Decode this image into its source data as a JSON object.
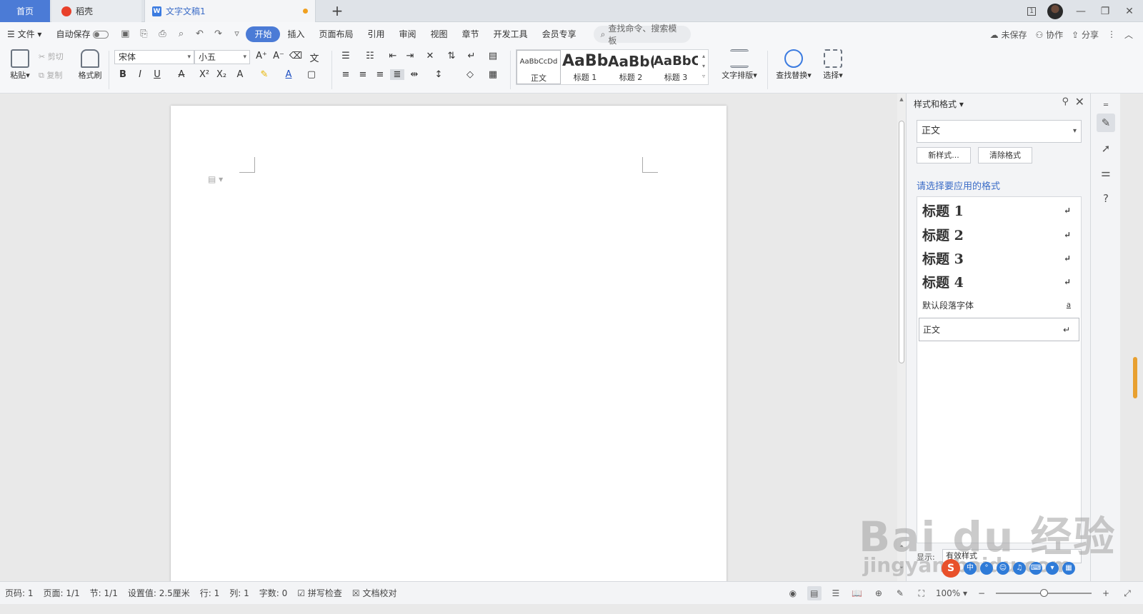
{
  "tabs": {
    "home": "首页",
    "daoke": "稻壳",
    "document": "文字文稿1"
  },
  "window": {
    "page_indicator": "1"
  },
  "menu": {
    "file": "文件",
    "autosave": "自动保存",
    "items": [
      "开始",
      "插入",
      "页面布局",
      "引用",
      "审阅",
      "视图",
      "章节",
      "开发工具",
      "会员专享"
    ],
    "active": "开始",
    "search_placeholder": "查找命令、搜索模板",
    "unsaved": "未保存",
    "collaborate": "协作",
    "share": "分享"
  },
  "ribbon": {
    "paste": "粘贴",
    "cut": "剪切",
    "copy": "复制",
    "format_painter": "格式刷",
    "font_name": "宋体",
    "font_size": "小五",
    "styles": [
      {
        "preview": "AaBbCcDd",
        "label": "正文"
      },
      {
        "preview": "AaBb",
        "label": "标题 1"
      },
      {
        "preview": "AaBb(",
        "label": "标题 2"
      },
      {
        "preview": "AaBbC",
        "label": "标题 3"
      }
    ],
    "text_layout": "文字排版",
    "find_replace": "查找替换",
    "select": "选择"
  },
  "side_panel": {
    "title": "样式和格式",
    "current_style": "正文",
    "new_style": "新样式...",
    "clear_format": "清除格式",
    "prompt": "请选择要应用的格式",
    "styles": [
      {
        "label": "标题 1",
        "mark": "↵",
        "kind": "heading"
      },
      {
        "label": "标题 2",
        "mark": "↵",
        "kind": "heading"
      },
      {
        "label": "标题 3",
        "mark": "↵",
        "kind": "heading"
      },
      {
        "label": "标题 4",
        "mark": "↵",
        "kind": "heading"
      },
      {
        "label": "默认段落字体",
        "mark": "a",
        "kind": "normal"
      },
      {
        "label": "正文",
        "mark": "↵",
        "kind": "selected"
      }
    ],
    "show_label": "显示:",
    "show_value": "有效样式"
  },
  "status": {
    "page_num": "页码: 1",
    "pages": "页面: 1/1",
    "section": "节: 1/1",
    "setting": "设置值: 2.5厘米",
    "row": "行: 1",
    "col": "列: 1",
    "word_count": "字数: 0",
    "spell_check": "拼写检查",
    "doc_check": "文档校对",
    "zoom": "100%",
    "zoom_level": 0.5
  },
  "watermark": {
    "main": "Bai du 经验",
    "sub": "jingyan.baidu.com"
  },
  "colors": {
    "accent": "#4b7bd6",
    "link": "#3b6cc7"
  }
}
